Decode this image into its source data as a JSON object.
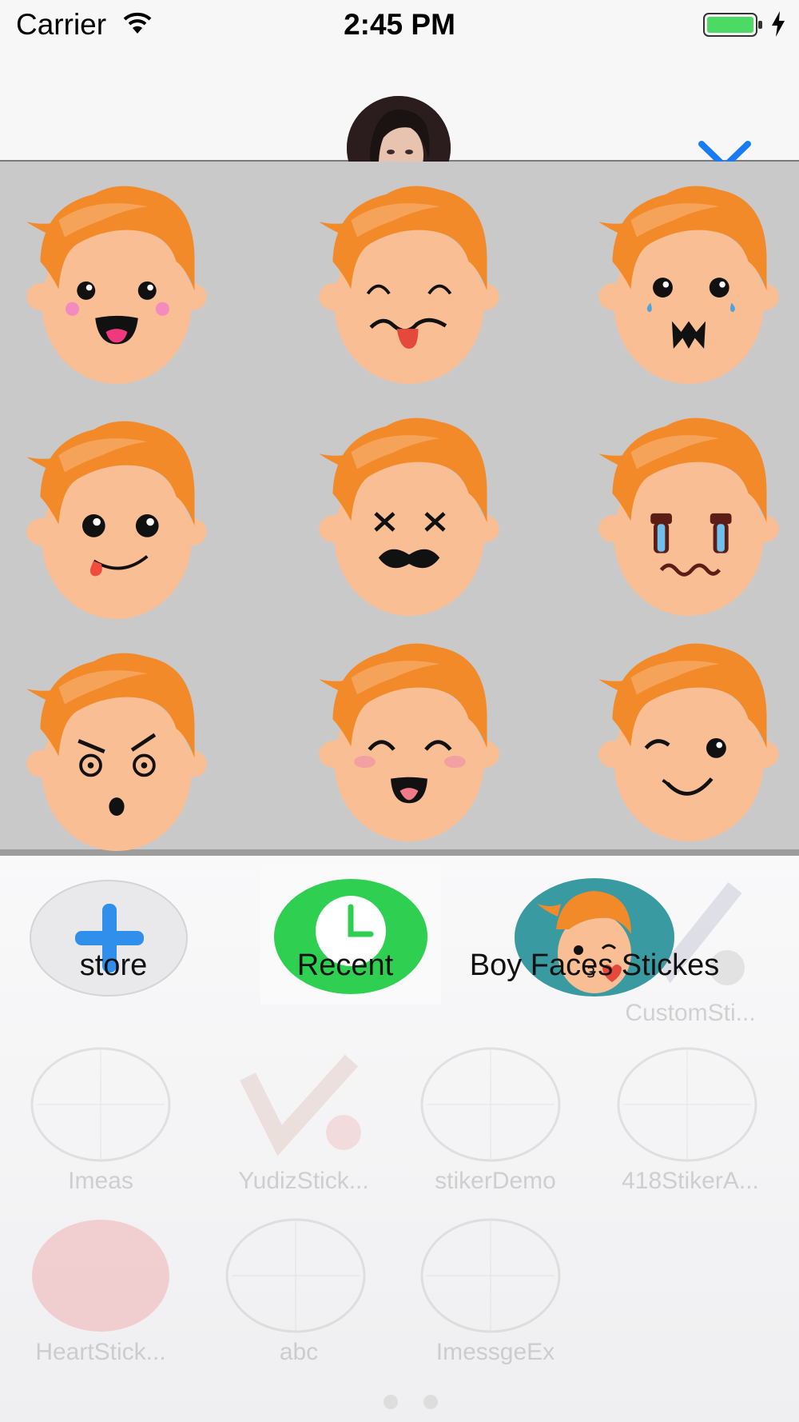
{
  "status_bar": {
    "carrier": "Carrier",
    "time": "2:45 PM",
    "battery_color": "#4cd964"
  },
  "header": {
    "avatar_icon": "user-avatar",
    "collapse_icon": "chevron-down-icon",
    "accent": "#1a7cf5"
  },
  "stickers": [
    {
      "name": "happy-tongue"
    },
    {
      "name": "squint-tongue"
    },
    {
      "name": "crying-fangs"
    },
    {
      "name": "smile-tongue"
    },
    {
      "name": "dizzy-x"
    },
    {
      "name": "tears-wavy"
    },
    {
      "name": "angry-shocked"
    },
    {
      "name": "laughing-blush"
    },
    {
      "name": "wink-smile"
    }
  ],
  "apps": [
    {
      "label": "store",
      "icon": "plus-icon"
    },
    {
      "label": "Recent",
      "icon": "clock-icon"
    },
    {
      "label": "Boy Faces Stickes",
      "icon": "boy-face-icon"
    }
  ],
  "background_apps": [
    "CustomSti...",
    "Imeas",
    "YudizStick...",
    "stikerDemo",
    "418StikerA...",
    "HeartStick...",
    "abc",
    "ImessgeEx"
  ]
}
